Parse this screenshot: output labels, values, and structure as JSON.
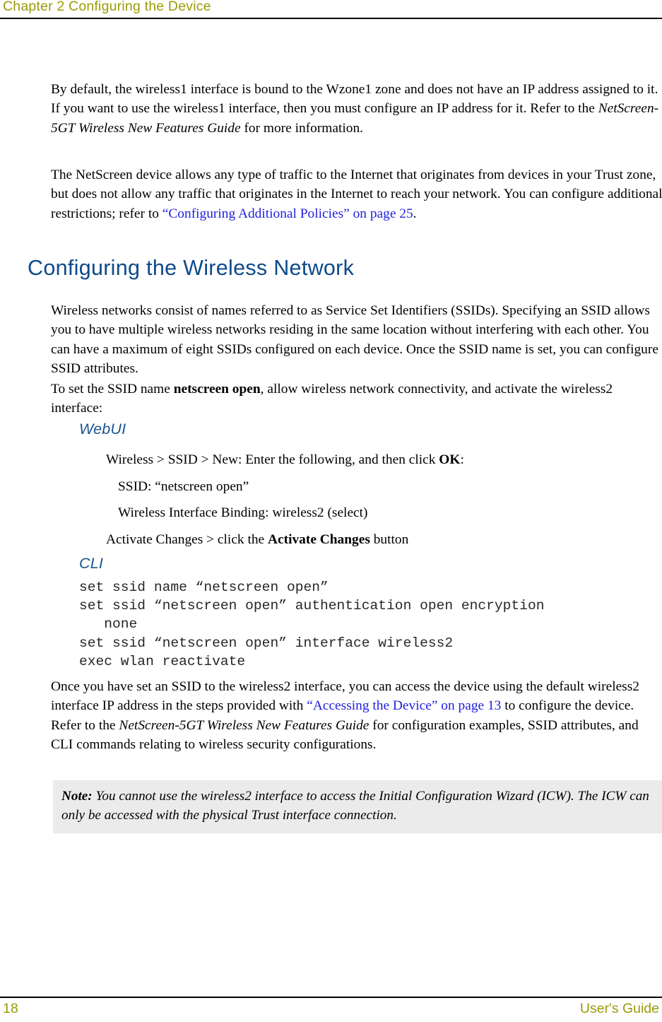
{
  "header": {
    "chapter_title": "Chapter 2 Configuring the Device"
  },
  "footer": {
    "page_number": "18",
    "guide_label": "User's Guide"
  },
  "colors": {
    "running_head": "#9a9c07",
    "section_heading": "#0d4a8a",
    "sub_heading": "#1a5490",
    "cross_reference": "#1f1fe0",
    "note_background": "#ebebeb",
    "body_text": "#000000"
  },
  "body": {
    "paragraph_1": {
      "run_1": "By default, the wireless1 interface is bound to the Wzone1 zone and does not have an IP address assigned to it. If you want to use the wireless1 interface, then you must configure an IP address for it. Refer to the ",
      "run_2_italic": "NetScreen-5GT Wireless New Features Guide",
      "run_3": " for more information."
    },
    "paragraph_2": {
      "run_1": "The NetScreen device allows any type of traffic to the Internet that originates from devices in your Trust zone, but does not allow any traffic that originates in the Internet to reach your network. You can configure additional restrictions; refer to ",
      "run_2_link": "“Configuring Additional Policies” on page 25",
      "run_3": "."
    },
    "section_heading": "Configuring the Wireless Network",
    "paragraph_4": "Wireless networks consist of names referred to as Service Set Identifiers (SSIDs). Specifying an SSID allows you to have multiple wireless networks residing in the same location without interfering with each other. You can have a maximum of eight SSIDs configured on each device. Once the SSID name is set, you can configure SSID attributes.",
    "paragraph_5": {
      "run_1": "To set the SSID name ",
      "run_2_bold": "netscreen open",
      "run_3": ", allow wireless network connectivity, and activate the wireless2 interface:"
    },
    "webui": {
      "heading": "WebUI",
      "steps": [
        {
          "run_1": "Wireless > SSID > New: Enter the following, and then click ",
          "run_2_bold": "OK",
          "run_3": ":"
        },
        {
          "run_1": "SSID: “netscreen open”"
        },
        {
          "run_1": "Wireless Interface Binding: wireless2 (select)"
        },
        {
          "run_1": "Activate Changes > click the ",
          "run_2_bold": "Activate Changes",
          "run_3": " button"
        }
      ]
    },
    "cli": {
      "heading": "CLI",
      "code": "set ssid name “netscreen open”\nset ssid “netscreen open” authentication open encryption\n   none\nset ssid “netscreen open” interface wireless2\nexec wlan reactivate"
    },
    "paragraph_6": {
      "run_1": "Once you have set an SSID to the wireless2 interface, you can access the device using the default wireless2 interface IP address in the steps provided with ",
      "run_2_link": "“Accessing the Device” on page 13",
      "run_3": " to configure the device. Refer to the ",
      "run_4_italic": "NetScreen-5GT Wireless New Features Guide",
      "run_5": " for configuration examples, SSID attributes, and CLI commands relating to wireless security configurations."
    },
    "note": {
      "label": "Note:",
      "text": " You cannot use the wireless2 interface to access the Initial Configuration Wizard (ICW). The ICW can only be accessed with the physical Trust interface connection."
    }
  }
}
